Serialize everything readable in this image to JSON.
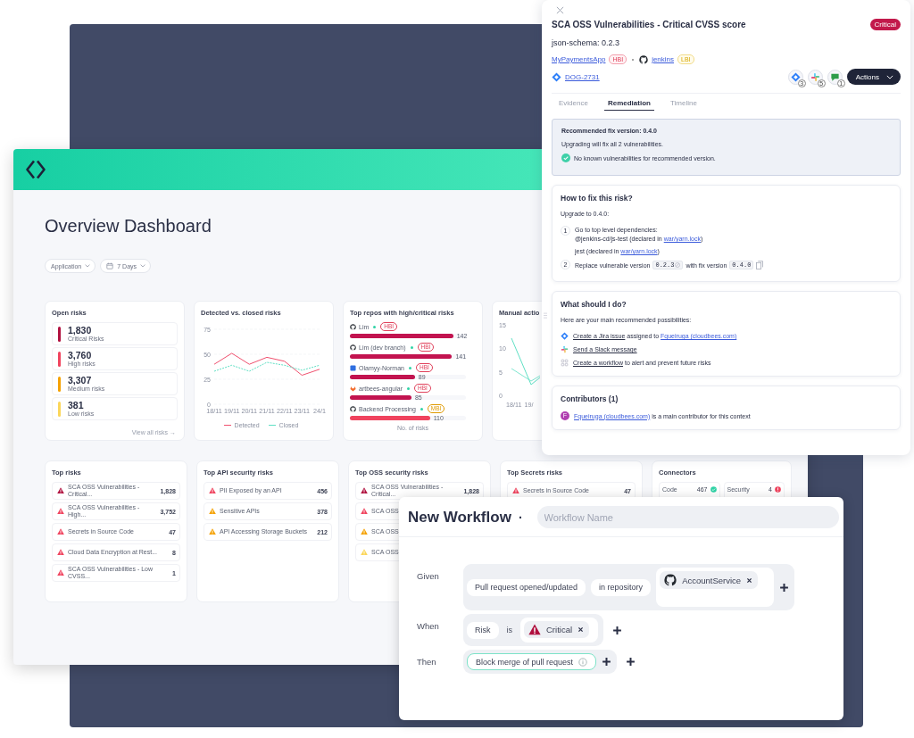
{
  "dashboard": {
    "title": "Overview Dashboard",
    "filters": [
      {
        "kind": "dropdown",
        "label": "Application"
      },
      {
        "kind": "date",
        "label": "7 Days"
      }
    ],
    "open_risks": {
      "title": "Open risks",
      "items": [
        {
          "count": "1,830",
          "label": "Critical Risks",
          "color": "#b0103f"
        },
        {
          "count": "3,760",
          "label": "High risks",
          "color": "#f0435e"
        },
        {
          "count": "3,307",
          "label": "Medium risks",
          "color": "#f5a100"
        },
        {
          "count": "381",
          "label": "Low risks",
          "color": "#fbd65a"
        }
      ],
      "link": "View all risks",
      "link_arrow": "→"
    },
    "detected_chart": {
      "chart_data": {
        "type": "line",
        "title": "Detected vs. closed risks",
        "categories": [
          "18/11",
          "19/11",
          "20/11",
          "21/11",
          "22/11",
          "23/11",
          "24/1"
        ],
        "ylim": [
          0,
          75
        ],
        "yticks": [
          0,
          25,
          50,
          75
        ],
        "series": [
          {
            "name": "Detected",
            "color": "#f0506e",
            "line_style": "solid",
            "values": [
              40,
              51,
              40,
              47,
              43,
              29,
              35
            ]
          },
          {
            "name": "Closed",
            "color": "#5fe0c4",
            "line_style": "dashed",
            "values": [
              33,
              39,
              33,
              42,
              39,
              34,
              39
            ]
          }
        ]
      }
    },
    "top_repos": {
      "title": "Top repos with high/critical risks",
      "axis_label": "No. of risks",
      "repos": [
        {
          "kind": "github",
          "name": "Lim",
          "badge": {
            "text": "HBI",
            "color": "#e0405a"
          },
          "level": 0.89,
          "value": "142",
          "color": "#c2134f"
        },
        {
          "kind": "github",
          "name": "Lim (dev branch)",
          "badge": {
            "text": "HBI",
            "color": "#e0405a"
          },
          "level": 0.88,
          "value": "141",
          "color": "#c2134f"
        },
        {
          "kind": "bitbucket",
          "name": "Olamyy-Norman",
          "badge": {
            "text": "HBI",
            "color": "#e0405a"
          },
          "level": 0.56,
          "value": "89",
          "color": "#c2134f"
        },
        {
          "kind": "gitlab",
          "name": "artbees-angular",
          "badge": {
            "text": "HBI",
            "color": "#e0405a"
          },
          "level": 0.53,
          "value": "85",
          "color": "#c2134f"
        },
        {
          "kind": "github",
          "name": "Backend Processing",
          "badge": {
            "text": "MBI",
            "color": "#e09a00"
          },
          "level": 0.69,
          "value": "110",
          "color": "#f0435e"
        }
      ]
    },
    "manual_actions": {
      "title": "Manual actio",
      "y_ticks": [
        "15",
        "10",
        "5",
        "0"
      ],
      "x_labels": [
        "18/11",
        "19/"
      ]
    },
    "lists": [
      {
        "title": "Top risks",
        "rows": [
          {
            "color": "#b0103f",
            "text": "SCA OSS Vulnerabilities - Critical...",
            "count": "1,828"
          },
          {
            "color": "#f0435e",
            "text": "SCA OSS Vulnerabilities - High...",
            "count": "3,752"
          },
          {
            "color": "#f0435e",
            "text": "Secrets in Source Code",
            "count": "47"
          },
          {
            "color": "#f0435e",
            "text": "Cloud Data Encryption at Rest...",
            "count": "8"
          },
          {
            "color": "#f0435e",
            "text": "SCA OSS Vulnerabilities - Low CVSS...",
            "count": "1"
          }
        ]
      },
      {
        "title": "Top API security risks",
        "rows": [
          {
            "color": "#f0435e",
            "text": "PII Exposed by an API",
            "count": "456"
          },
          {
            "color": "#f5a100",
            "text": "Sensitive APIs",
            "count": "378"
          },
          {
            "color": "#f5a100",
            "text": "API Accessing Storage Buckets",
            "count": "212"
          }
        ]
      },
      {
        "title": "Top OSS security risks",
        "rows": [
          {
            "color": "#b0103f",
            "text": "SCA OSS Vulnerabilities - Critical...",
            "count": "1,828"
          },
          {
            "color": "#f0435e",
            "text": "SCA OSS"
          },
          {
            "color": "#f5a100",
            "text": "SCA OSS"
          },
          {
            "color": "#fbd65a",
            "text": "SCA OSS"
          }
        ]
      },
      {
        "title": "Top Secrets risks",
        "rows": [
          {
            "color": "#f0435e",
            "text": "Secrets in Source Code",
            "count": "47"
          }
        ]
      }
    ],
    "connectors": {
      "title": "Connectors",
      "items": [
        {
          "kind": "ok",
          "label": "Code",
          "count": "467"
        },
        {
          "kind": "error",
          "label": "Security",
          "count": "4"
        }
      ]
    }
  },
  "risk_panel": {
    "title": "SCA OSS Vulnerabilities - Critical CVSS score",
    "severity_badge": "Critical",
    "package": "json-schema: 0.2.3",
    "app_link": "MyPaymentsApp",
    "app_badge": "HBI",
    "repo_link": "jenkins",
    "repo_badge": "LBI",
    "ticket": "DOG-2731",
    "integrations": [
      {
        "kind": "jira",
        "count": "3"
      },
      {
        "kind": "slack",
        "count": "5"
      },
      {
        "kind": "chat",
        "count": "1"
      }
    ],
    "actions_button": "Actions",
    "tabs": [
      {
        "label": "Evidence",
        "selected": false
      },
      {
        "label": "Remediation",
        "selected": true
      },
      {
        "label": "Timeline",
        "selected": false
      }
    ],
    "recommended": {
      "title": "Recommended fix version: 0.4.0",
      "text": "Upgrading will fix all 2 vulnerabilities.",
      "note": "No known vulnerabilities for recommended version."
    },
    "how_to_fix": {
      "title": "How to fix this risk?",
      "intro": "Upgrade to 0.4.0:",
      "step_1": {
        "number": "1",
        "text": "Go to top level dependencies:",
        "dependencies": [
          {
            "text": "@jenkins-cd/js-test (declared in ",
            "link": "war/yarn.lock",
            "after": ")"
          },
          {
            "text": "jest (declared in ",
            "link": "war/yarn.lock",
            "after": ")"
          }
        ]
      },
      "step_2": {
        "number": "2",
        "text": "Replace vulnerable version",
        "from_version": "0.2.3",
        "middle": "with fix version",
        "to_version": "0.4.0"
      }
    },
    "what_to_do": {
      "title": "What should I do?",
      "intro": "Here are your main recommended possibilities:",
      "options": [
        {
          "kind": "jira",
          "link": "Create a Jira issue",
          "text": " assigned to ",
          "person": "Fqueiruga (cloudbees.com)"
        },
        {
          "kind": "slack",
          "link": "Send a Slack message"
        },
        {
          "kind": "workflow",
          "link": "Create a workflow",
          "text": " to alert and prevent future risks"
        }
      ]
    },
    "contributors": {
      "title": "Contributors (1)",
      "items": [
        {
          "initial": "F",
          "name": "Fqueiruga (cloudbees.com)",
          "text": " is a main contributor for this context"
        }
      ]
    }
  },
  "workflow": {
    "title": "New Workflow",
    "separator": "·",
    "name_placeholder": "Workflow Name",
    "rows": [
      {
        "label": "Given",
        "outer_add": false,
        "items": [
          {
            "kind": "pill",
            "text": "Pull request opened/updated"
          },
          {
            "kind": "pill",
            "text": "in repository"
          },
          {
            "kind": "chip-box",
            "chips": [
              {
                "kind": "repository",
                "text": "AccountService"
              }
            ]
          },
          {
            "kind": "add"
          }
        ]
      },
      {
        "label": "When",
        "outer_add": true,
        "items": [
          {
            "kind": "pill",
            "text": "Risk"
          },
          {
            "kind": "text",
            "text": "is"
          },
          {
            "kind": "chip-box",
            "chips": [
              {
                "kind": "risk",
                "text": "Critical"
              }
            ]
          }
        ]
      },
      {
        "label": "Then",
        "outer_add": true,
        "items": [
          {
            "kind": "action",
            "text": "Block merge of pull request"
          },
          {
            "kind": "add"
          }
        ]
      }
    ]
  }
}
